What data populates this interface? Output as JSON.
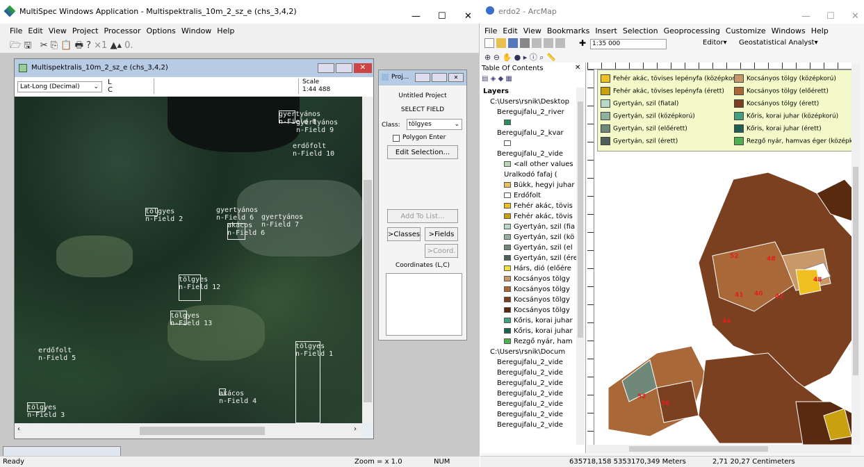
{
  "multispec": {
    "title": "MultiSpec Windows Application - Multispektralis_10m_2_sz_e (chs_3,4,2)",
    "menu": [
      "File",
      "Edit",
      "View",
      "Project",
      "Processor",
      "Options",
      "Window",
      "Help"
    ],
    "image_window": {
      "title": "Multispektralis_10m_2_sz_e (chs_3,4,2)",
      "coord_select": "Lat-Long (Decimal)",
      "l_label": "L",
      "c_label": "C",
      "scale_label": "Scale",
      "scale_value": "1:44 488"
    },
    "fields": [
      {
        "text": "gyertyános\nn-Field 8"
      },
      {
        "text": "gyertyános\nn-Field 9"
      },
      {
        "text": "erdőfolt\nn-Field 10"
      },
      {
        "text": "tölgyes\nn-Field 2"
      },
      {
        "text": "gyertyános\nn-Field 6"
      },
      {
        "text": "gyertyános\nn-Field 7"
      },
      {
        "text": "akácos\nn-Field 6"
      },
      {
        "text": "tölgyes\nn-Field 12"
      },
      {
        "text": "tölgyes\nn-Field 13"
      },
      {
        "text": "erdőfolt\nn-Field 5"
      },
      {
        "text": "tölgyes\nn-Field 1"
      },
      {
        "text": "akácos\nn-Field 4"
      },
      {
        "text": "tölgyes\nn-Field 3"
      }
    ],
    "project": {
      "title": "Proj...",
      "name": "Untitled Project",
      "mode": "SELECT FIELD",
      "class_label": "Class:",
      "class_value": "tölgyes",
      "polygon_label": "Polygon Enter",
      "edit_selection": "Edit Selection...",
      "add_to_list": "Add To List...",
      "classes_btn": ">Classes",
      "fields_btn": ">Fields",
      "coord_btn": ">Coord.",
      "coordinates_label": "Coordinates (L,C)"
    },
    "status": {
      "ready": "Ready",
      "zoom": "Zoom = x 1.0",
      "num": "NUM"
    }
  },
  "arcmap": {
    "title": "erdo2 - ArcMap",
    "menu": [
      "File",
      "Edit",
      "View",
      "Bookmarks",
      "Insert",
      "Selection",
      "Geoprocessing",
      "Customize",
      "Windows",
      "Help"
    ],
    "scale": "1:35 000",
    "editor": "Editor",
    "geostat": "Geostatistical Analyst",
    "toc_title": "Table Of Contents",
    "toc": [
      {
        "label": "Layers",
        "indent": 0,
        "sw": ""
      },
      {
        "label": "C:\\Users\\rsnik\\Desktop",
        "indent": 1,
        "sw": ""
      },
      {
        "label": "Beregujfalu_2_river",
        "indent": 2,
        "sw": ""
      },
      {
        "label": "",
        "indent": 3,
        "sw": "#2e8b57"
      },
      {
        "label": "Beregujfalu_2_kvar",
        "indent": 2,
        "sw": ""
      },
      {
        "label": "",
        "indent": 3,
        "sw": "#ffffff"
      },
      {
        "label": "Beregujfalu_2_vide",
        "indent": 2,
        "sw": ""
      },
      {
        "label": "<all other values",
        "indent": 3,
        "sw": "#b5d9b0"
      },
      {
        "label": "Uralkodó fafaj (",
        "indent": 3,
        "sw": ""
      },
      {
        "label": "Bükk, hegyi juhar",
        "indent": 3,
        "sw": "#e8c060"
      },
      {
        "label": "Erdőfolt",
        "indent": 3,
        "sw": "#ffffff"
      },
      {
        "label": "Fehér akác, tövis",
        "indent": 3,
        "sw": "#f0c020"
      },
      {
        "label": "Fehér akác, tövis",
        "indent": 3,
        "sw": "#c8a010"
      },
      {
        "label": "Gyertyán, szil (fia",
        "indent": 3,
        "sw": "#b8d8c8"
      },
      {
        "label": "Gyertyán, szil (kö",
        "indent": 3,
        "sw": "#90b0a0"
      },
      {
        "label": "Gyertyán, szil (el",
        "indent": 3,
        "sw": "#708878"
      },
      {
        "label": "Gyertyán, szil (ére",
        "indent": 3,
        "sw": "#506058"
      },
      {
        "label": "Hárs, dió (előére",
        "indent": 3,
        "sw": "#f4e040"
      },
      {
        "label": "Kocsányos tölgy",
        "indent": 3,
        "sw": "#c89868"
      },
      {
        "label": "Kocsányos tölgy",
        "indent": 3,
        "sw": "#a86838"
      },
      {
        "label": "Kocsányos tölgy",
        "indent": 3,
        "sw": "#7a4020"
      },
      {
        "label": "Kocsányos tölgy",
        "indent": 3,
        "sw": "#5a2a10"
      },
      {
        "label": "Kőris, korai juhar",
        "indent": 3,
        "sw": "#40a080"
      },
      {
        "label": "Kőris, korai juhar",
        "indent": 3,
        "sw": "#206050"
      },
      {
        "label": "Rezgő nyár, ham",
        "indent": 3,
        "sw": "#50b050"
      },
      {
        "label": "C:\\Users\\rsnik\\Docum",
        "indent": 1,
        "sw": ""
      },
      {
        "label": "Beregujfalu_2_vide",
        "indent": 2,
        "sw": ""
      },
      {
        "label": "Beregujfalu_2_vide",
        "indent": 2,
        "sw": ""
      },
      {
        "label": "Beregujfalu_2_vide",
        "indent": 2,
        "sw": ""
      },
      {
        "label": "Beregujfalu_2_vide",
        "indent": 2,
        "sw": ""
      },
      {
        "label": "Beregujfalu_2_vide",
        "indent": 2,
        "sw": ""
      },
      {
        "label": "Beregujfalu_2_vide",
        "indent": 2,
        "sw": ""
      },
      {
        "label": "Beregujfalu_2_vide",
        "indent": 2,
        "sw": ""
      }
    ],
    "legend_left": [
      {
        "label": "Fehér akác, tövises lepényfa (középkorú)",
        "color": "#f0c020"
      },
      {
        "label": "Fehér akác, tövises lepényfa (érett)",
        "color": "#c8a010"
      },
      {
        "label": "Gyertyán, szil (fiatal)",
        "color": "#b8d8c8"
      },
      {
        "label": "Gyertyán, szil (középkorú)",
        "color": "#90b0a0"
      },
      {
        "label": "Gyertyán, szil (előérett)",
        "color": "#708878"
      },
      {
        "label": "Gyertyán, szil (érett)",
        "color": "#506058"
      }
    ],
    "legend_right": [
      {
        "label": "Kocsányos tölgy (középkorú)",
        "color": "#c89868"
      },
      {
        "label": "Kocsányos tölgy (előérett)",
        "color": "#a86838"
      },
      {
        "label": "Kocsányos tölgy (érett)",
        "color": "#7a4020"
      },
      {
        "label": "Kőris, korai juhar (középkorú)",
        "color": "#40a080"
      },
      {
        "label": "Kőris, korai juhar (érett)",
        "color": "#206050"
      },
      {
        "label": "Rezgő nyár, hamvas éger (középkorú)",
        "color": "#50b050"
      }
    ],
    "parcels": [
      "48",
      "48",
      "52",
      "40",
      "41",
      "42",
      "44",
      "52",
      "56"
    ],
    "status": {
      "coords": "635718,158  5353170,349 Meters",
      "size": "2,71  20,27 Centimeters"
    }
  }
}
